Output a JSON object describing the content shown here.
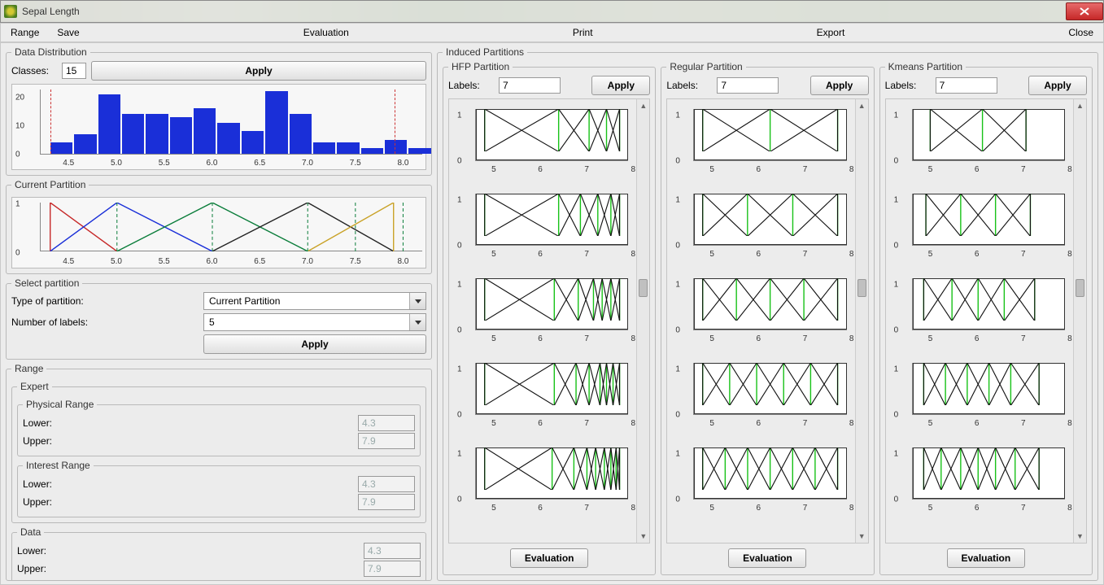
{
  "window": {
    "title": "Sepal Length"
  },
  "menu": {
    "range": "Range",
    "save": "Save",
    "evaluation": "Evaluation",
    "print": "Print",
    "export": "Export",
    "close": "Close"
  },
  "dist": {
    "legend": "Data Distribution",
    "classes_label": "Classes:",
    "classes_value": "15",
    "apply": "Apply"
  },
  "chart_data": {
    "histogram": {
      "type": "bar",
      "xlabel": "",
      "ylabel": "",
      "xticks": [
        4.5,
        5.0,
        5.5,
        6.0,
        6.5,
        7.0,
        7.5,
        8.0
      ],
      "yticks": [
        0,
        10,
        20
      ],
      "ylim": [
        0,
        23
      ],
      "xlim": [
        4.2,
        8.2
      ],
      "bin_width": 0.25,
      "bins_x": [
        4.3,
        4.55,
        4.8,
        5.05,
        5.3,
        5.55,
        5.8,
        6.05,
        6.3,
        6.55,
        6.8,
        7.05,
        7.3,
        7.55,
        7.8,
        8.05
      ],
      "bins_height": [
        4,
        7,
        21,
        14,
        14,
        13,
        16,
        11,
        8,
        22,
        14,
        4,
        4,
        2,
        5,
        2
      ],
      "ref_lines_x": [
        4.3,
        7.9
      ]
    },
    "current_partition": {
      "type": "fuzzy-triangular",
      "xlim": [
        4.2,
        8.2
      ],
      "xticks": [
        4.5,
        5.0,
        5.5,
        6.0,
        6.5,
        7.0,
        7.5,
        8.0
      ],
      "yticks": [
        0,
        1
      ],
      "n_labels": 5,
      "centers": [
        4.3,
        5.0,
        6.0,
        7.0,
        7.9
      ],
      "ref_lines_x": [
        5.0,
        6.0,
        7.0,
        7.5,
        8.0
      ],
      "colors": [
        "#c62828",
        "#1a2fd8",
        "#0a7d3a",
        "#222",
        "#c9a227"
      ]
    },
    "hfp_rows": [
      {
        "centers": [
          4.8,
          6.5,
          7.2,
          7.6,
          7.9
        ]
      },
      {
        "centers": [
          4.8,
          6.5,
          7.0,
          7.4,
          7.7,
          7.9
        ]
      },
      {
        "centers": [
          4.8,
          6.4,
          6.95,
          7.3,
          7.5,
          7.7,
          7.9
        ]
      },
      {
        "centers": [
          4.8,
          6.4,
          6.9,
          7.2,
          7.45,
          7.6,
          7.75,
          7.9
        ]
      },
      {
        "centers": [
          4.8,
          6.35,
          6.85,
          7.15,
          7.35,
          7.55,
          7.7,
          7.82,
          7.9
        ]
      }
    ],
    "regular_rows": [
      {
        "centers": [
          4.8,
          6.35,
          7.9
        ]
      },
      {
        "centers": [
          4.8,
          5.83,
          6.87,
          7.9
        ]
      },
      {
        "centers": [
          4.8,
          5.575,
          6.35,
          7.125,
          7.9
        ]
      },
      {
        "centers": [
          4.8,
          5.42,
          6.04,
          6.66,
          7.28,
          7.9
        ]
      },
      {
        "centers": [
          4.8,
          5.317,
          5.833,
          6.35,
          6.867,
          7.383,
          7.9
        ]
      }
    ],
    "kmeans_rows": [
      {
        "centers": [
          5.0,
          6.2,
          7.2
        ]
      },
      {
        "centers": [
          4.9,
          5.7,
          6.5,
          7.3
        ]
      },
      {
        "centers": [
          4.85,
          5.5,
          6.1,
          6.7,
          7.4
        ]
      },
      {
        "centers": [
          4.85,
          5.35,
          5.85,
          6.35,
          6.85,
          7.5
        ]
      },
      {
        "centers": [
          4.85,
          5.25,
          5.7,
          6.1,
          6.5,
          6.95,
          7.5
        ]
      }
    ],
    "mini_xticks": [
      5,
      6,
      7,
      8
    ],
    "mini_xlim": [
      4.6,
      8.1
    ],
    "mini_yticks": [
      0,
      1
    ]
  },
  "curpart_legend": "Current Partition",
  "select_partition": {
    "legend": "Select partition",
    "type_label": "Type of partition:",
    "type_value": "Current Partition",
    "num_label": "Number of labels:",
    "num_value": "5",
    "apply": "Apply"
  },
  "range_fs": {
    "legend": "Range",
    "expert_legend": "Expert",
    "phys_legend": "Physical Range",
    "int_legend": "Interest Range",
    "data_legend": "Data",
    "lower_label": "Lower:",
    "upper_label": "Upper:",
    "lower_val": "4.3",
    "upper_val": "7.9"
  },
  "induced": {
    "legend": "Induced Partitions",
    "hfp": "HFP Partition",
    "regular": "Regular Partition",
    "kmeans": "Kmeans Partition",
    "labels_label": "Labels:",
    "labels_value": "7",
    "apply": "Apply",
    "evaluation": "Evaluation"
  }
}
